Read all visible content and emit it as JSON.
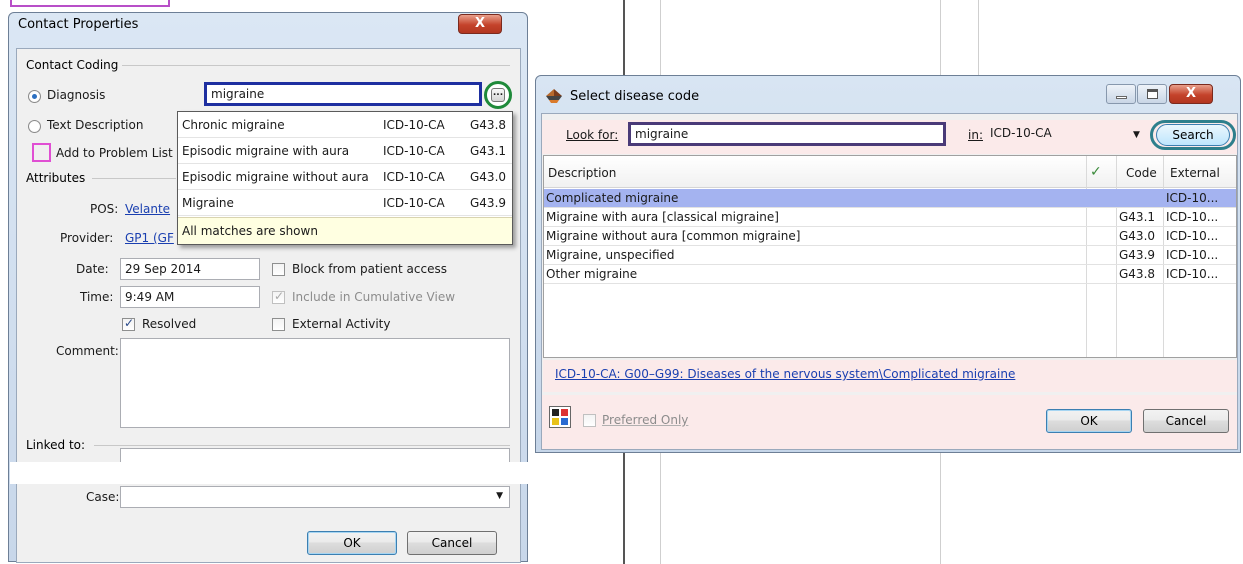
{
  "contact_properties": {
    "title": "Contact Properties",
    "close_label": "X",
    "coding_group": "Contact Coding",
    "diagnosis_label": "Diagnosis",
    "text_description_label": "Text Description",
    "add_problem_list_label": "Add to Problem List",
    "diagnosis_value": "migraine",
    "ellipsis_label": "...",
    "dropdown": {
      "items": [
        {
          "name": "Chronic migraine",
          "system": "ICD-10-CA",
          "code": "G43.8"
        },
        {
          "name": "Episodic migraine with aura",
          "system": "ICD-10-CA",
          "code": "G43.1"
        },
        {
          "name": "Episodic migraine without aura",
          "system": "ICD-10-CA",
          "code": "G43.0"
        },
        {
          "name": "Migraine",
          "system": "ICD-10-CA",
          "code": "G43.9"
        }
      ],
      "footer": "All matches are shown"
    },
    "attributes_group": "Attributes",
    "pos_label": "POS:",
    "pos_value": "Velante",
    "provider_label": "Provider:",
    "provider_value": "GP1 (GF",
    "date_label": "Date:",
    "date_value": "29 Sep 2014",
    "time_label": "Time:",
    "time_value": "9:49 AM",
    "block_label": "Block from patient access",
    "cumulative_label": "Include in Cumulative View",
    "resolved_label": "Resolved",
    "external_activity_label": "External Activity",
    "comment_label": "Comment:",
    "linked_to_label": "Linked to:",
    "case_label": "Case:",
    "ok_label": "OK",
    "cancel_label": "Cancel"
  },
  "select_disease": {
    "title": "Select disease code",
    "look_for_label": "Look for:",
    "look_for_value": "migraine",
    "in_label": "in:",
    "in_value": "ICD-10-CA",
    "search_label": "Search",
    "columns": {
      "description": "Description",
      "check": "✓",
      "code": "Code",
      "external": "External"
    },
    "rows": [
      {
        "description": "Complicated migraine",
        "code": "",
        "external": "ICD-10..."
      },
      {
        "description": "Migraine with aura [classical migraine]",
        "code": "G43.1",
        "external": "ICD-10..."
      },
      {
        "description": "Migraine without aura [common migraine]",
        "code": "G43.0",
        "external": "ICD-10..."
      },
      {
        "description": "Migraine, unspecified",
        "code": "G43.9",
        "external": "ICD-10..."
      },
      {
        "description": "Other migraine",
        "code": "G43.8",
        "external": "ICD-10..."
      }
    ],
    "path": "ICD-10-CA: G00–G99: Diseases of the nervous system\\Complicated migraine",
    "preferred_only_label": "Preferred Only",
    "ok_label": "OK",
    "cancel_label": "Cancel"
  },
  "colors": {
    "highlight_blue": "#1e2fa0",
    "highlight_green": "#1f8a3a",
    "highlight_magenta": "#e04fd3",
    "highlight_teal": "#2e7f8c",
    "highlight_purple": "#4a3a78",
    "selection": "#a4b3f0",
    "close_red": "#c4432b"
  }
}
